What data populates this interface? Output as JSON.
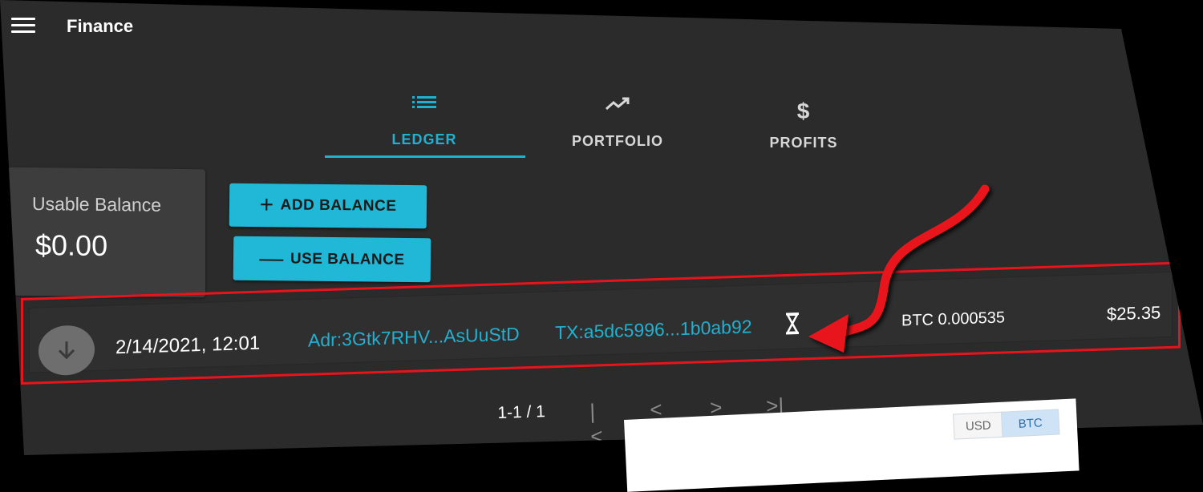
{
  "header": {
    "title": "Finance",
    "menu_icon": "menu-icon"
  },
  "tabs": [
    {
      "label": "LEDGER",
      "icon": "list-icon",
      "active": true
    },
    {
      "label": "PORTFOLIO",
      "icon": "trending-up-icon",
      "active": false
    },
    {
      "label": "PROFITS",
      "icon": "dollar-icon",
      "active": false
    }
  ],
  "balance": {
    "label": "Usable Balance",
    "value": "$0.00"
  },
  "actions": {
    "add_icon": "+",
    "add_label": "ADD BALANCE",
    "use_icon": "—",
    "use_label": "USE BALANCE"
  },
  "ledger": {
    "rows": [
      {
        "direction_icon": "arrow-down-icon",
        "date": "2/14/2021, 12:01",
        "address": "Adr:3Gtk7RHV...AsUuStD",
        "tx": "TX:a5dc5996...1b0ab92",
        "status_icon": "hourglass-icon",
        "btc": "BTC 0.000535",
        "usd": "$25.35"
      }
    ]
  },
  "pagination": {
    "range": "1-1 / 1",
    "first": "|<",
    "prev": "<",
    "next": ">",
    "last": ">|"
  },
  "currency_toggle": {
    "usd": "USD",
    "btc": "BTC"
  },
  "colors": {
    "accent": "#22b0d0",
    "highlight": "#e8141c",
    "background": "#2b2b2b"
  }
}
